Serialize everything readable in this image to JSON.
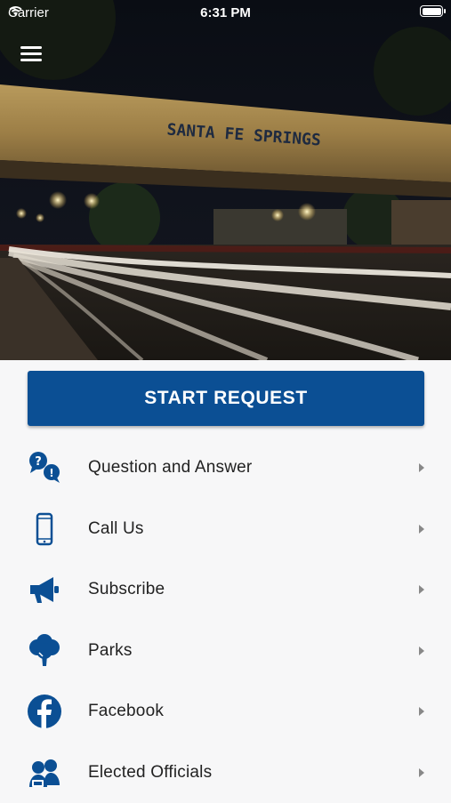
{
  "status_bar": {
    "carrier": "Carrier",
    "time": "6:31 PM"
  },
  "hero": {
    "sign_text": "SANTA FE SPRINGS"
  },
  "start_button": {
    "label": "START REQUEST"
  },
  "menu": [
    {
      "label": "Question and Answer",
      "icon": "question-answer-icon"
    },
    {
      "label": "Call Us",
      "icon": "phone-icon"
    },
    {
      "label": "Subscribe",
      "icon": "megaphone-icon"
    },
    {
      "label": "Parks",
      "icon": "tree-icon"
    },
    {
      "label": "Facebook",
      "icon": "facebook-icon"
    },
    {
      "label": "Elected Officials",
      "icon": "officials-icon"
    }
  ],
  "colors": {
    "primary": "#0b4f94",
    "background": "#f7f7f8",
    "text": "#222222",
    "chevron": "#888888"
  }
}
